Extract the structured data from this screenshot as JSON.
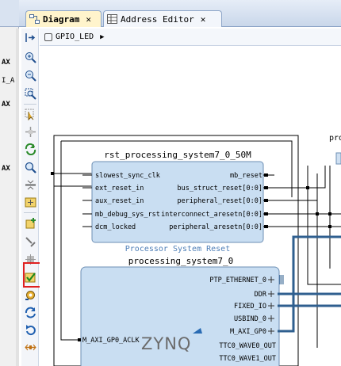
{
  "left_panel": {
    "rows": [
      "AX",
      "I_A",
      "AX",
      "AX"
    ]
  },
  "tabs": [
    {
      "label": "Diagram",
      "active": true,
      "icon": "diagram-icon"
    },
    {
      "label": "Address Editor",
      "active": false,
      "icon": "table-icon"
    }
  ],
  "breadcrumb": {
    "label": "GPIO_LED",
    "icon": "hierarchy-icon"
  },
  "toolbar": {
    "buttons": [
      "fit-to-pane-icon",
      "zoom-in-icon",
      "zoom-out-icon",
      "zoom-area-icon",
      "select-icon",
      "move-icon",
      "regenerate-layout-icon",
      "search-icon",
      "collapse-icon",
      "expand-icon",
      "add-ip-icon",
      "make-connection-icon",
      "settings-icon",
      "validate-design-icon",
      "run-automation-icon",
      "refresh-icon",
      "reload-icon",
      "pin-icon"
    ],
    "highlighted": "validate-design-icon"
  },
  "diagram": {
    "partial_label": "proc",
    "rst_block": {
      "instance_name": "rst_processing_system7_0_50M",
      "ip_name": "Processor System Reset",
      "inputs": [
        "slowest_sync_clk",
        "ext_reset_in",
        "aux_reset_in",
        "mb_debug_sys_rst",
        "dcm_locked"
      ],
      "outputs": [
        "mb_reset",
        "bus_struct_reset[0:0]",
        "peripheral_reset[0:0]",
        "interconnect_aresetn[0:0]",
        "peripheral_aresetn[0:0]"
      ]
    },
    "ps_block": {
      "instance_name": "processing_system7_0",
      "logo": "ZYNQ",
      "inputs": [
        "M_AXI_GP0_ACLK"
      ],
      "outputs": [
        "PTP_ETHERNET_0",
        "DDR",
        "FIXED_IO",
        "USBIND_0",
        "M_AXI_GP0",
        "TTC0_WAVE0_OUT",
        "TTC0_WAVE1_OUT"
      ]
    },
    "colors": {
      "block_fill": "#c9def2",
      "block_border": "#6d8fb4",
      "ip_label": "#4f7fb7",
      "bus_wire": "#2f5f8f",
      "highlight": "#e02020"
    }
  }
}
